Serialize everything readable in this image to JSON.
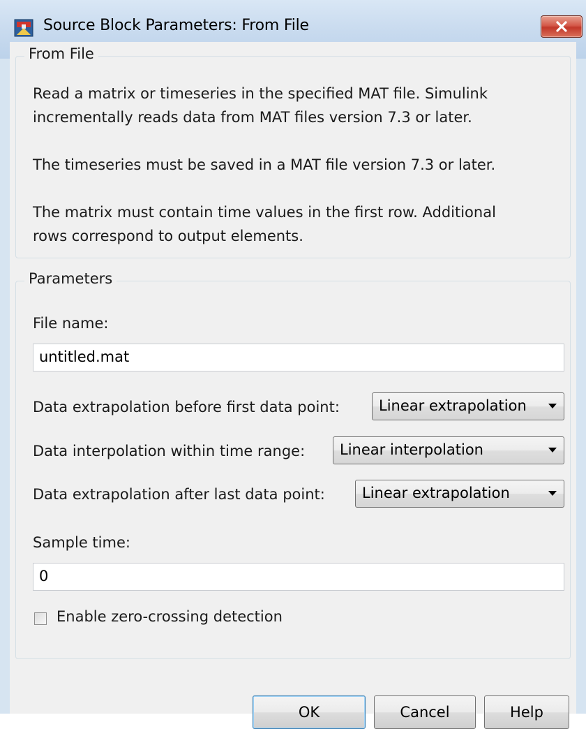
{
  "window": {
    "title": "Source Block Parameters: From File"
  },
  "from_file_group": {
    "title": "From File",
    "paragraphs": [
      [
        "Read a matrix or timeseries in the specified MAT file. Simulink",
        "incrementally reads data from MAT files version 7.3 or later."
      ],
      [
        "The timeseries must be saved in a MAT file version 7.3 or later."
      ],
      [
        "The matrix must contain time values in the first row. Additional",
        "rows correspond to output elements."
      ]
    ]
  },
  "parameters_group": {
    "title": "Parameters",
    "file_name_label": "File name:",
    "file_name_value": "untitled.mat",
    "extrap_before_label": "Data extrapolation before first data point:",
    "extrap_before_value": "Linear extrapolation",
    "interp_label": "Data interpolation within time range:",
    "interp_value": "Linear interpolation",
    "extrap_after_label": "Data extrapolation after last data point:",
    "extrap_after_value": "Linear extrapolation",
    "sample_time_label": "Sample time:",
    "sample_time_value": "0",
    "zero_crossing_label": "Enable zero-crossing detection",
    "zero_crossing_checked": false
  },
  "buttons": {
    "ok": "OK",
    "cancel": "Cancel",
    "help": "Help"
  },
  "icons": {
    "app": "simulink-block-icon",
    "close": "close-icon",
    "dropdown": "chevron-down-icon"
  },
  "colors": {
    "titlebar": "#c9dbef",
    "close_button": "#c8473a",
    "dialog_bg": "#f0f0f0"
  }
}
